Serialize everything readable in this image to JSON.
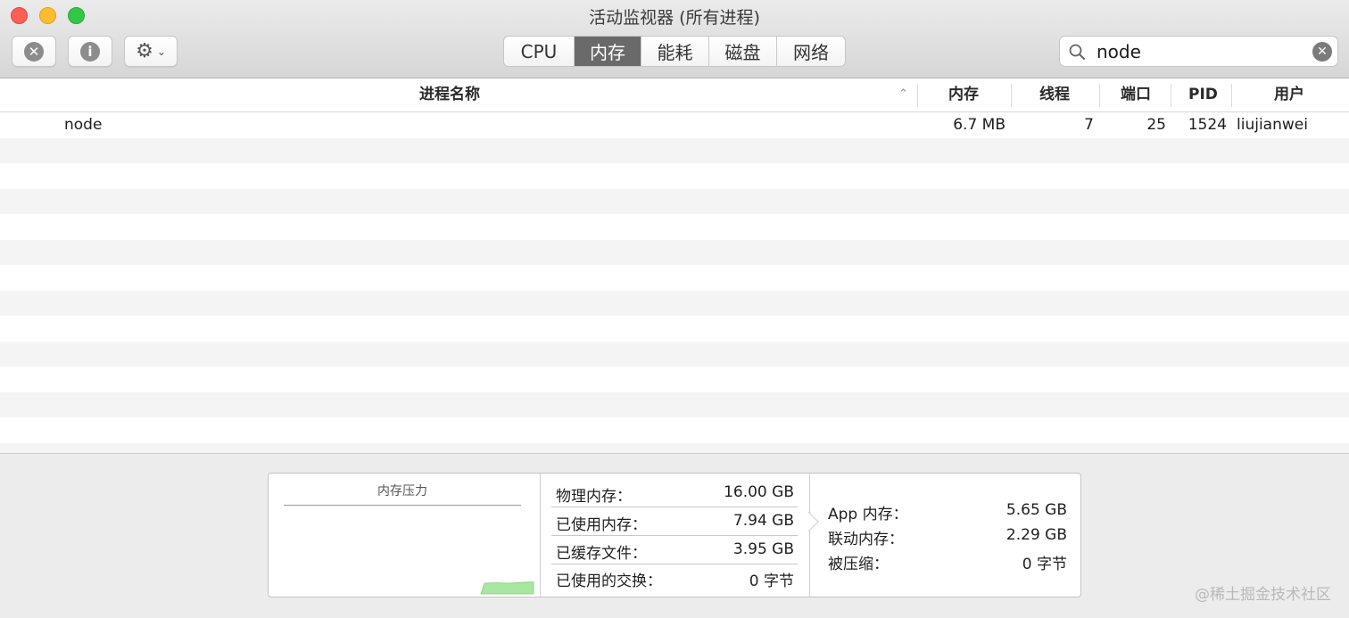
{
  "window": {
    "title": "活动监视器 (所有进程)"
  },
  "toolbar": {
    "stop_icon": "stop-process-icon",
    "info_icon": "info-icon",
    "gear_icon": "gear-icon",
    "stop_glyph": "✕",
    "info_glyph": "i",
    "gear_glyph": "⚙",
    "chevron_glyph": "⌄"
  },
  "tabs": [
    {
      "label": "CPU",
      "active": false
    },
    {
      "label": "内存",
      "active": true
    },
    {
      "label": "能耗",
      "active": false
    },
    {
      "label": "磁盘",
      "active": false
    },
    {
      "label": "网络",
      "active": false
    }
  ],
  "search": {
    "value": "node",
    "clear_glyph": "✕"
  },
  "table": {
    "headers": {
      "name": "进程名称",
      "memory": "内存",
      "threads": "线程",
      "ports": "端口",
      "pid": "PID",
      "user": "用户"
    },
    "sort_glyph": "⌃",
    "rows": [
      {
        "name": "node",
        "memory": "6.7 MB",
        "threads": "7",
        "ports": "25",
        "pid": "1524",
        "user": "liujianwei"
      }
    ]
  },
  "memory_panel": {
    "pressure_title": "内存压力",
    "pressure_color": "#a8e6a1",
    "left_stats": [
      {
        "label": "物理内存：",
        "value": "16.00 GB"
      },
      {
        "label": "已使用内存：",
        "value": "7.94 GB"
      },
      {
        "label": "已缓存文件：",
        "value": "3.95 GB"
      },
      {
        "label": "已使用的交换：",
        "value": "0 字节"
      }
    ],
    "right_stats": [
      {
        "label": "App 内存：",
        "value": "5.65 GB"
      },
      {
        "label": "联动内存：",
        "value": "2.29 GB"
      },
      {
        "label": "被压缩：",
        "value": "0 字节"
      }
    ]
  },
  "watermark": "@稀土掘金技术社区"
}
